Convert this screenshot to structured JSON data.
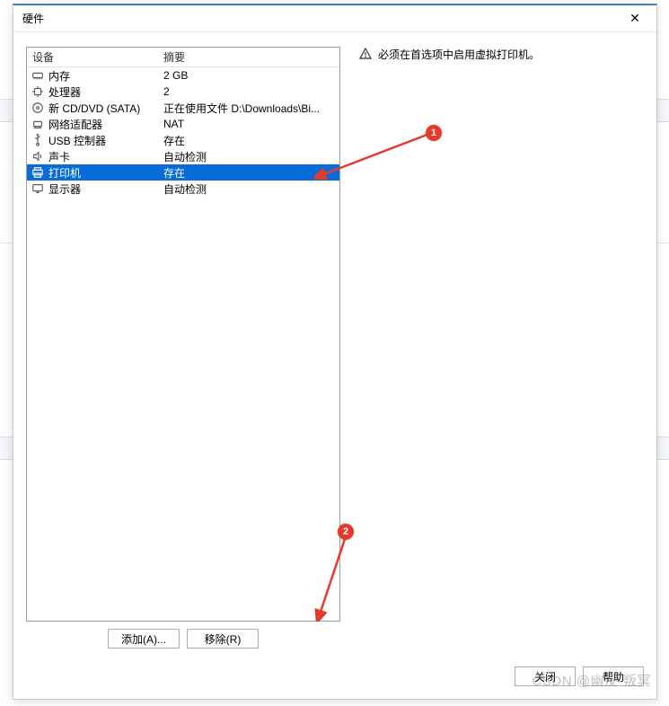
{
  "dialog": {
    "title": "硬件",
    "close": "✕"
  },
  "columns": {
    "device": "设备",
    "summary": "摘要"
  },
  "devices": [
    {
      "icon": "memory-icon",
      "name": "内存",
      "summary": "2 GB",
      "selected": false
    },
    {
      "icon": "cpu-icon",
      "name": "处理器",
      "summary": "2",
      "selected": false
    },
    {
      "icon": "disc-icon",
      "name": "新 CD/DVD (SATA)",
      "summary": "正在使用文件 D:\\Downloads\\Bi...",
      "selected": false
    },
    {
      "icon": "network-icon",
      "name": "网络适配器",
      "summary": "NAT",
      "selected": false
    },
    {
      "icon": "usb-icon",
      "name": "USB 控制器",
      "summary": "存在",
      "selected": false
    },
    {
      "icon": "sound-icon",
      "name": "声卡",
      "summary": "自动检测",
      "selected": false
    },
    {
      "icon": "printer-icon",
      "name": "打印机",
      "summary": "存在",
      "selected": true
    },
    {
      "icon": "display-icon",
      "name": "显示器",
      "summary": "自动检测",
      "selected": false
    }
  ],
  "buttons": {
    "add": "添加(A)...",
    "remove": "移除(R)"
  },
  "info": {
    "message": "必须在首选项中启用虚拟打印机。"
  },
  "footer": {
    "close": "关闭",
    "help": "帮助"
  },
  "callouts": {
    "c1": "1",
    "c2": "2"
  },
  "watermark": "CSDN @幽反-叛冥"
}
